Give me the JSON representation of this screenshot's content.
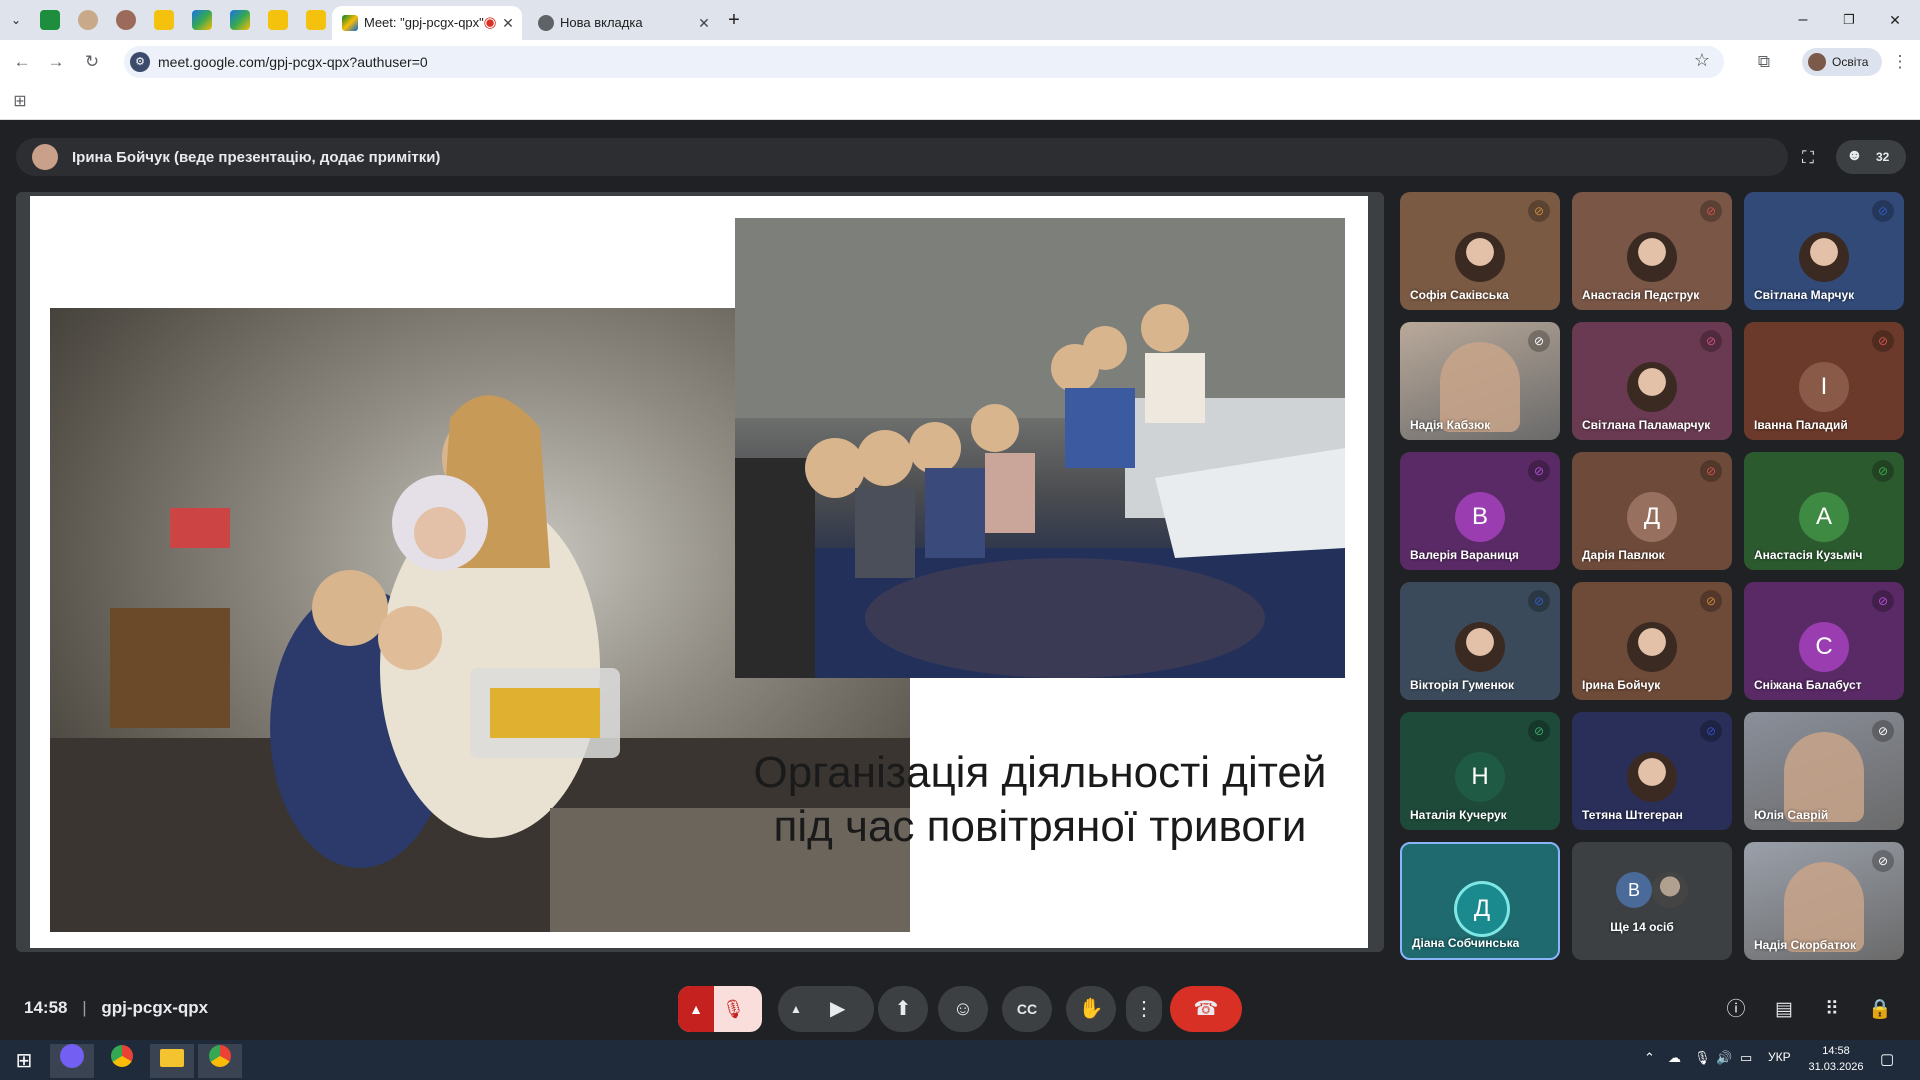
{
  "browser": {
    "tabs": [
      {
        "label": "Meet: \"gpj-pcgx-qpx\"",
        "active": true
      },
      {
        "label": "Нова вкладка",
        "active": false
      }
    ],
    "new_tab": "+",
    "url": "meet.google.com/gpj-pcgx-qpx?authuser=0",
    "profile_label": "Освіта",
    "window_controls": {
      "minimize": "–",
      "restore": "❐",
      "close": "✕"
    }
  },
  "meet": {
    "presenter_text": "Ірина Бойчук (веде презентацію, додає примітки)",
    "participant_count": "32",
    "slide_title_line1": "Організація діяльності дітей",
    "slide_title_line2": "під час повітряної тривоги",
    "participants": [
      {
        "name": "Софія Саківська",
        "kind": "photo",
        "color": "#7a5a43",
        "mic": "#c98a3a"
      },
      {
        "name": "Анастасія Педструк",
        "kind": "photo",
        "color": "#7a5646",
        "mic": "#d05050"
      },
      {
        "name": "Світлана Марчук",
        "kind": "photo",
        "color": "#324a78",
        "mic": "#2f5cc0"
      },
      {
        "name": "Надія Кабзюк",
        "kind": "video",
        "color": "#b9a99a",
        "mic": "#444"
      },
      {
        "name": "Світлана Паламарчук",
        "kind": "photo",
        "color": "#6a3a52",
        "mic": "#d05080"
      },
      {
        "name": "Іванна Паладий",
        "kind": "letter",
        "letter": "І",
        "color": "#6b3a2b",
        "avatar": "#8a5a48",
        "mic": "#d05050"
      },
      {
        "name": "Валерія Вараниця",
        "kind": "letter",
        "letter": "В",
        "color": "#5a2a66",
        "avatar": "#9a3db0",
        "mic": "#b050d0"
      },
      {
        "name": "Дарія Павлюк",
        "kind": "letter",
        "letter": "Д",
        "color": "#6e4a3a",
        "avatar": "#987060",
        "mic": "#d05050"
      },
      {
        "name": "Анастасія Кузьміч",
        "kind": "letter",
        "letter": "А",
        "color": "#2c5a2f",
        "avatar": "#3e8a42",
        "mic": "#3ea848"
      },
      {
        "name": "Вікторія Гуменюк",
        "kind": "photo",
        "color": "#3a4a5a",
        "mic": "#2f5cc0"
      },
      {
        "name": "Ірина Бойчук",
        "kind": "photo",
        "color": "#6e4a38",
        "mic": "#c98a3a"
      },
      {
        "name": "Сніжана Балабуст",
        "kind": "letter",
        "letter": "С",
        "color": "#5a2a66",
        "avatar": "#9a3db0",
        "mic": "#b050d0"
      },
      {
        "name": "Наталія Кучерук",
        "kind": "letter",
        "letter": "Н",
        "color": "#1e4a3a",
        "avatar": "#1e5a44",
        "mic": "#3ea868"
      },
      {
        "name": "Тетяна Штегеран",
        "kind": "photo",
        "color": "#2a2f5a",
        "mic": "#3050c0"
      },
      {
        "name": "Юлія Саврій",
        "kind": "video",
        "color": "#8a8f9a",
        "mic": "#444"
      },
      {
        "name": "Діана Собчинська",
        "kind": "letter",
        "letter": "Д",
        "color": "#1e6a6e",
        "avatar": "#1a8a8e",
        "mic": ""
      },
      {
        "name": "Ще 14 осіб",
        "kind": "more",
        "letter": "В",
        "color": "#3c4043",
        "avatar": "#4a6a9a",
        "mic": ""
      },
      {
        "name": "Надія Скорбатюк",
        "kind": "video",
        "color": "#9aa0aa",
        "mic": "#444"
      }
    ],
    "meeting_time": "14:58",
    "meeting_code": "gpj-pcgx-qpx"
  },
  "taskbar": {
    "language": "УКР",
    "time": "14:58",
    "date": "31.03.2026"
  },
  "icons": {
    "back": "back-arrow-icon",
    "forward": "forward-arrow-icon",
    "reload": "reload-icon",
    "mic_off": "mic-off-icon",
    "camera": "camera-icon",
    "present": "present-screen-icon",
    "emoji": "emoji-icon",
    "captions": "captions-icon",
    "hand": "raise-hand-icon",
    "more": "more-vert-icon",
    "end_call": "end-call-icon"
  }
}
